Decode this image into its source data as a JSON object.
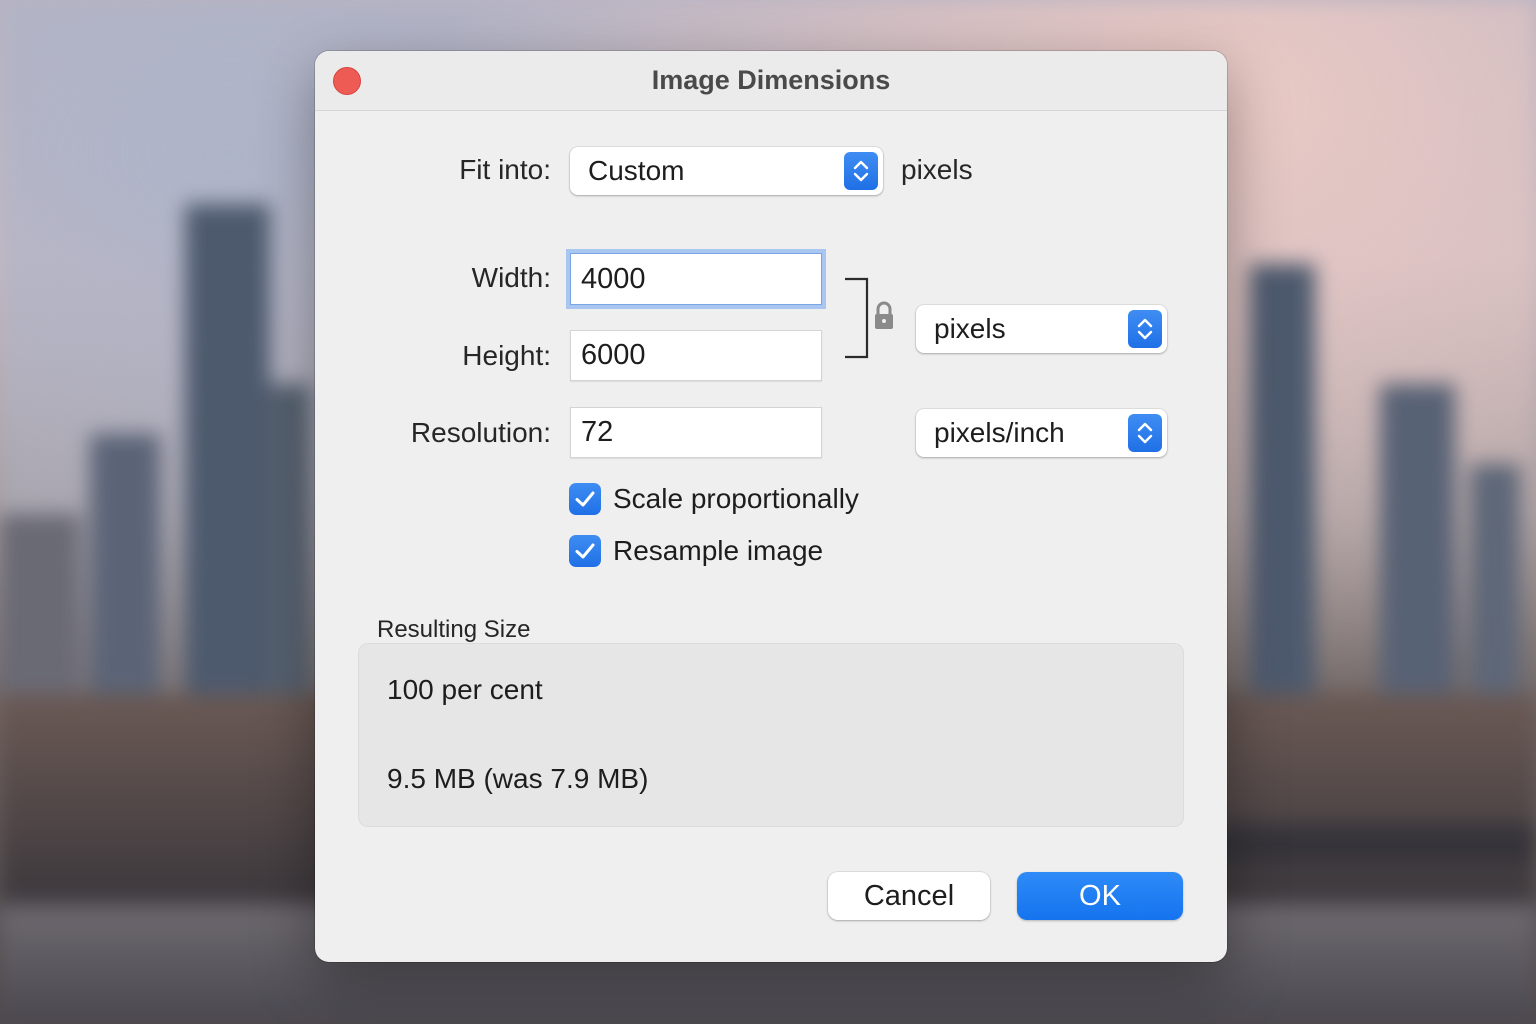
{
  "dialog": {
    "title": "Image Dimensions",
    "fit_into": {
      "label": "Fit into:",
      "value": "Custom",
      "unit": "pixels"
    },
    "width": {
      "label": "Width:",
      "value": "4000"
    },
    "height": {
      "label": "Height:",
      "value": "6000"
    },
    "resolution": {
      "label": "Resolution:",
      "value": "72"
    },
    "size_unit": {
      "value": "pixels"
    },
    "resolution_unit": {
      "value": "pixels/inch"
    },
    "scale_proportionally": {
      "label": "Scale proportionally",
      "checked": true
    },
    "resample_image": {
      "label": "Resample image",
      "checked": true
    },
    "resulting_size": {
      "heading": "Resulting Size",
      "percent": "100 per cent",
      "file_size": "9.5 MB (was 7.9 MB)"
    },
    "buttons": {
      "cancel": "Cancel",
      "ok": "OK"
    }
  },
  "colors": {
    "accent": "#1f70e6",
    "close": "#ee5b54"
  }
}
